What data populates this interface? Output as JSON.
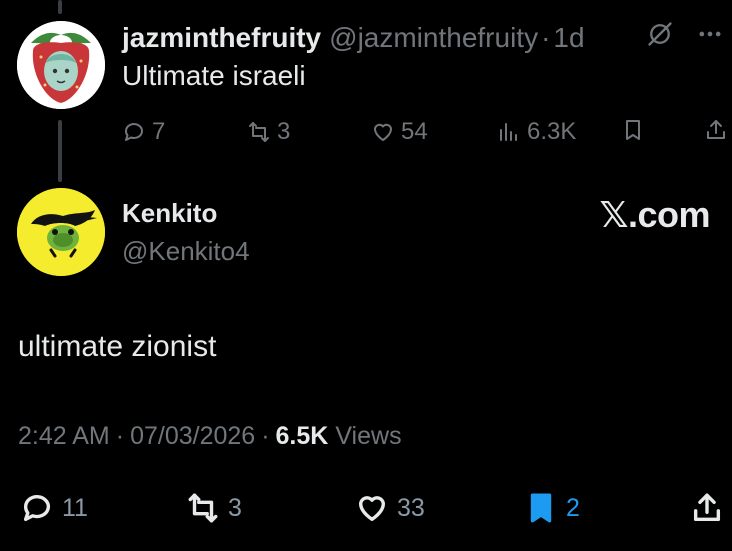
{
  "parent_tweet": {
    "display_name": "jazminthefruity",
    "handle": "@jazminthefruity",
    "separator": "·",
    "time": "1d",
    "text": "Ultimate israeli",
    "icons": [
      "grok-icon",
      "more-icon"
    ],
    "actions": {
      "replies": "7",
      "reposts": "3",
      "likes": "54",
      "views": "6.3K"
    }
  },
  "main_tweet": {
    "display_name": "Kenkito",
    "handle": "@Kenkito4",
    "brand": "𝕏.com",
    "text": "ultimate zionist",
    "timestamp": "2:42 AM",
    "date": "07/03/2026",
    "separator": "·",
    "views_count": "6.5K",
    "views_label": "Views",
    "actions": {
      "replies": "11",
      "reposts": "3",
      "likes": "33",
      "bookmarks": "2"
    }
  },
  "colors": {
    "background": "#000000",
    "primary_text": "#e7e9ea",
    "secondary_text": "#71767b",
    "accent": "#1d9bf0",
    "avatar_yellow": "#f4ec2c"
  }
}
